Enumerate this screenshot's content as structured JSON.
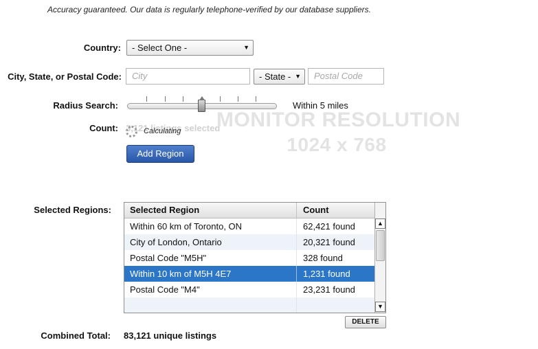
{
  "notice": {
    "strong": "Accuracy guaranteed.",
    "text": "Our data is regularly telephone-verified by our database suppliers."
  },
  "country": {
    "label": "Country:",
    "value": "- Select One -"
  },
  "location": {
    "label": "City, State, or Postal Code:",
    "city_placeholder": "City",
    "state_value": "- State -",
    "postal_placeholder": "Postal Code"
  },
  "radius": {
    "label": "Radius Search:",
    "value_text": "Within 5 miles",
    "position_fraction": 0.5
  },
  "count": {
    "label": "Count:",
    "value_text": "3,121 listings selected",
    "status": "Calculating"
  },
  "watermark": {
    "line1": "MONITOR RESOLUTION",
    "line2": "1024 x 768"
  },
  "add_region_label": "Add Region",
  "regions": {
    "label": "Selected Regions:",
    "headers": [
      "Selected Region",
      "Count"
    ],
    "rows": [
      {
        "region": "Within 60 km of Toronto, ON",
        "count": "62,421 found"
      },
      {
        "region": "City of London, Ontario",
        "count": "20,321 found"
      },
      {
        "region": "Postal Code \"M5H\"",
        "count": "328 found"
      },
      {
        "region": "Within 10 km of M5H 4E7",
        "count": "1,231 found"
      },
      {
        "region": "Postal Code \"M4\"",
        "count": "23,231 found"
      }
    ],
    "selected_index": 3
  },
  "delete_label": "DELETE",
  "combined": {
    "label": "Combined Total:",
    "value": "83,121 unique listings"
  },
  "icons": {
    "select_arrow": "▼",
    "scroll_up": "▲",
    "scroll_down": "▼"
  },
  "colors": {
    "accent": "#2c76c7",
    "button": "#3a68b8"
  }
}
